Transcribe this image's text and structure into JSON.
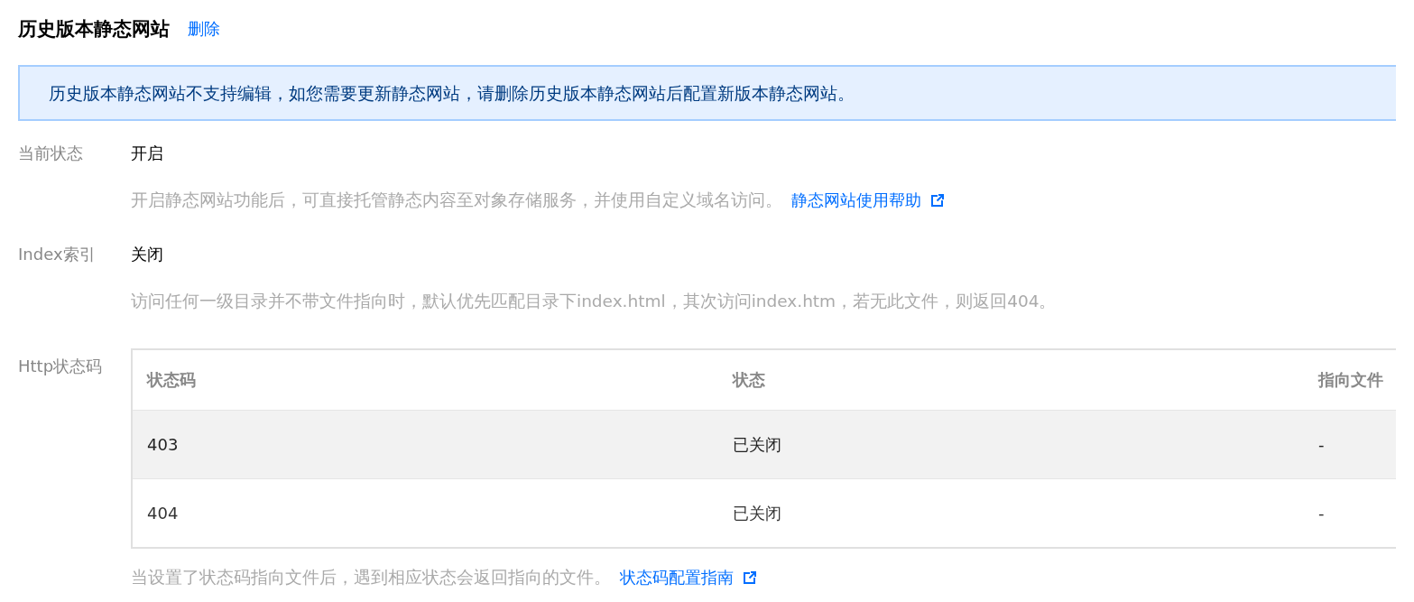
{
  "header": {
    "title": "历史版本静态网站",
    "delete_link": "删除"
  },
  "notice": "历史版本静态网站不支持编辑，如您需要更新静态网站，请删除历史版本静态网站后配置新版本静态网站。",
  "fields": [
    {
      "kind": "text",
      "label": "当前状态",
      "value": "开启",
      "help": "开启静态网站功能后，可直接托管静态内容至对象存储服务，并使用自定义域名访问。",
      "help_link": "静态网站使用帮助"
    },
    {
      "kind": "text",
      "label": "Index索引",
      "value": "关闭",
      "help": "访问任何一级目录并不带文件指向时，默认优先匹配目录下index.html，其次访问index.htm，若无此文件，则返回404。"
    },
    {
      "kind": "table",
      "label": "Http状态码",
      "columns": [
        "状态码",
        "状态",
        "指向文件"
      ],
      "rows": [
        {
          "cells": [
            "403",
            "已关闭",
            "-"
          ],
          "hovered": true
        },
        {
          "cells": [
            "404",
            "已关闭",
            "-"
          ],
          "hovered": false
        }
      ],
      "help": "当设置了状态码指向文件后，遇到相应状态会返回指向的文件。",
      "help_link": "状态码配置指南"
    }
  ]
}
